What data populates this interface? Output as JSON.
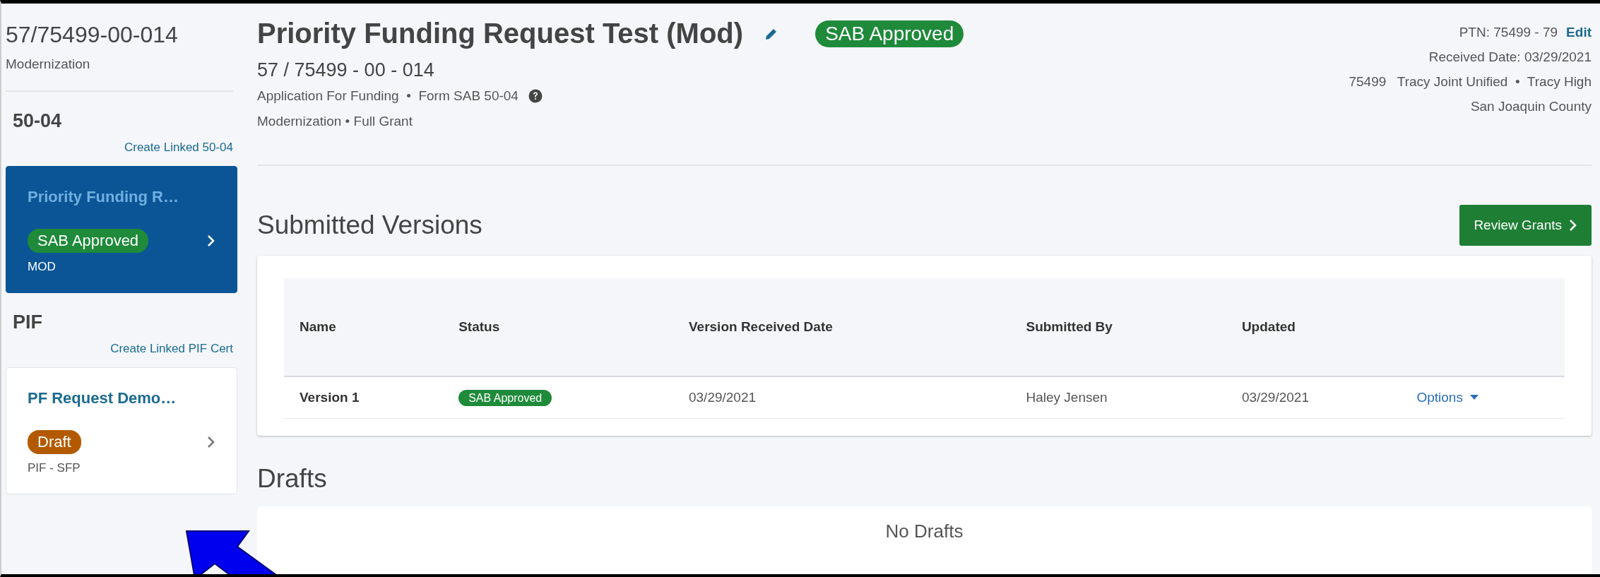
{
  "sidebar": {
    "title": "57/75499-00-014",
    "subtitle": "Modernization",
    "sections": [
      {
        "heading": "50-04",
        "link": "Create Linked 50-04",
        "cards": [
          {
            "title": "Priority Funding R…",
            "status": {
              "label": "SAB Approved",
              "kind": "approved"
            },
            "code": "MOD",
            "selected": true
          }
        ]
      },
      {
        "heading": "PIF",
        "link": "Create Linked PIF Cert",
        "cards": [
          {
            "title": "PF Request Demo…",
            "status": {
              "label": "Draft",
              "kind": "draft"
            },
            "code": "PIF - SFP",
            "selected": false
          }
        ]
      }
    ]
  },
  "header": {
    "title": "Priority Funding Request Test (Mod)",
    "status": {
      "label": "SAB Approved",
      "kind": "approved"
    },
    "number": "57 / 75499 - 00 - 014",
    "meta": "Application For Funding  •  Form SAB 50-04",
    "program": "Modernization • Full Grant",
    "ptn": "PTN: 75499 - 79",
    "ptn_link": "Edit",
    "received": "Received Date: 03/29/2021",
    "district": "75499   Tracy Joint Unified  •  Tracy High",
    "county": "San Joaquin County"
  },
  "submitted_versions": {
    "heading": "Submitted Versions",
    "button": "Review Grants",
    "table": {
      "columns": [
        "Name",
        "Status",
        "Version Received Date",
        "Submitted By",
        "Updated"
      ],
      "rows": [
        {
          "name": "Version 1",
          "status": {
            "label": "SAB Approved",
            "kind": "approved"
          },
          "received": "03/29/2021",
          "submitted_by": "Haley Jensen",
          "updated": "03/29/2021",
          "action": "Options"
        }
      ]
    }
  },
  "drafts": {
    "heading": "Drafts",
    "empty": "No Drafts"
  }
}
